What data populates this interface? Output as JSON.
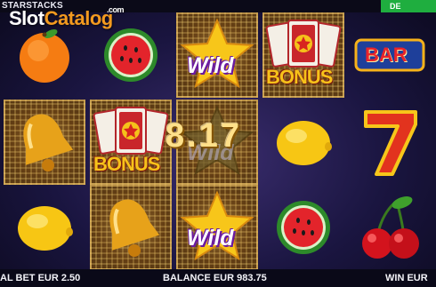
{
  "header": {
    "game_title": "STARSTACKS",
    "top_right_button": "DE"
  },
  "watermark": {
    "part1": "Slot",
    "part2": "Catalog",
    "suffix": ".com"
  },
  "reels": [
    [
      "orange",
      "watermelon",
      "",
      "lemon"
    ],
    [
      "bell",
      "bonus",
      "bell"
    ],
    [
      "wild",
      "wild",
      "wild"
    ],
    [
      "bonus",
      "lemon",
      "watermelon"
    ],
    [
      "bar",
      "seven",
      "cherries"
    ]
  ],
  "symbol_labels": {
    "wild": "Wild",
    "bonus": "BONUS",
    "bar": "BAR"
  },
  "win_display": "8.17",
  "footer": {
    "total_bet": "AL BET EUR 2.50",
    "balance": "BALANCE EUR 983.75",
    "win": "WIN EUR"
  },
  "colors": {
    "accent_green": "#1fae3f",
    "watermark_orange": "#f39a1f",
    "win_gold": "#ffe08a"
  }
}
